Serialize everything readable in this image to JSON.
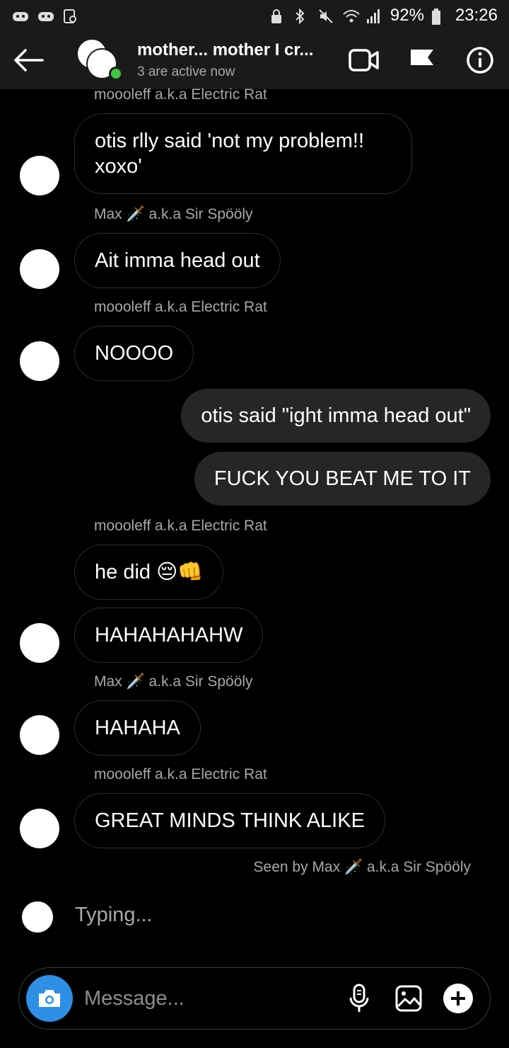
{
  "status_bar": {
    "battery": "92%",
    "time": "23:26"
  },
  "header": {
    "title": "mother... mother I cr...",
    "subtitle": "3 are active now"
  },
  "messages": [
    {
      "sender": "moooleff a.k.a Electric Rat",
      "lines": [
        "otis rlly said 'not my problem!!",
        "xoxo'"
      ]
    },
    {
      "sender": "Max 🗡️ a.k.a Sir Spööly",
      "text": "Ait imma head out"
    },
    {
      "sender": "moooleff a.k.a Electric Rat",
      "text": "NOOOO"
    },
    {
      "text": "otis said \"ight imma head out\""
    },
    {
      "text": "FUCK YOU BEAT ME TO IT"
    },
    {
      "sender": "moooleff a.k.a Electric Rat",
      "text": "he did 😔👊"
    },
    {
      "text": "HAHAHAHAHW"
    },
    {
      "sender": "Max 🗡️ a.k.a Sir Spööly",
      "text": "HAHAHA"
    },
    {
      "sender": "moooleff a.k.a Electric Rat",
      "text": "GREAT MINDS THINK ALIKE"
    }
  ],
  "seen_by": "Seen by Max 🗡️ a.k.a Sir Spööly",
  "typing": "Typing...",
  "composer": {
    "placeholder": "Message..."
  },
  "colors": {
    "accent": "#2d8fe6",
    "active_dot": "#3ec43e",
    "outgoing_bubble": "#262626",
    "meta_text": "#a8a8a8"
  },
  "icons": {
    "back": "back-arrow-icon",
    "video": "video-call-icon",
    "flag": "flag-icon",
    "info": "info-icon",
    "camera": "camera-icon",
    "mic": "microphone-icon",
    "gallery": "gallery-icon",
    "plus": "add-icon"
  }
}
